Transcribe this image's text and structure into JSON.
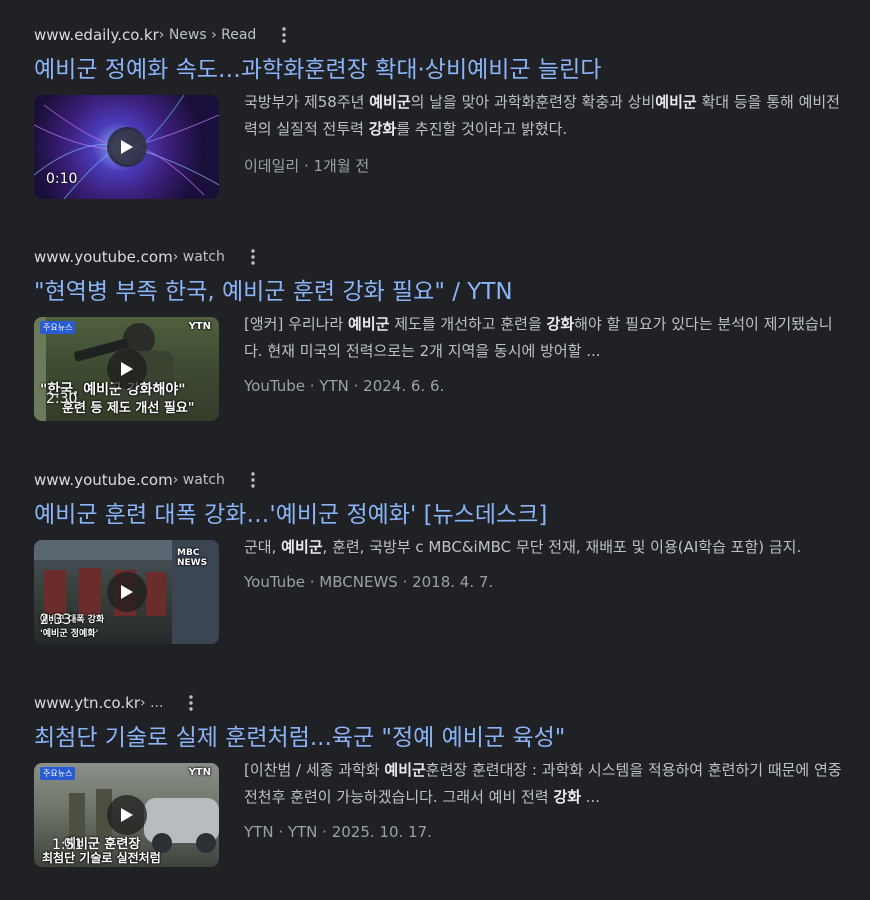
{
  "results": [
    {
      "site": "www.edaily.co.kr",
      "crumb": " › News › Read",
      "title": "예비군 정예화 속도…과학화훈련장 확대·상비예비군 늘린다",
      "duration": "0:10",
      "snippet": [
        {
          "t": "국방부가 제58주년 "
        },
        {
          "b": "예비군"
        },
        {
          "t": "의 날을 맞아 과학화훈련장 확충과 상비"
        },
        {
          "b": "예비군"
        },
        {
          "t": " 확대 등을 통해 예비전력의 실질적 전투력 "
        },
        {
          "b": "강화"
        },
        {
          "t": "를 추진할 것이라고 밝혔다."
        }
      ],
      "meta": "이데일리 · 1개월 전"
    },
    {
      "site": "www.youtube.com",
      "crumb": " › watch",
      "title": "\"현역병 부족 한국, 예비군 훈련 강화 필요\" / YTN",
      "duration": "2:30",
      "thumb_text": [
        "\"한국, 예비군 강화해야\"",
        "훈련 등 제도 개선 필요\""
      ],
      "thumb_badge": "주요뉴스",
      "thumb_logo": "YTN",
      "snippet": [
        {
          "t": "[앵커] 우리나라 "
        },
        {
          "b": "예비군"
        },
        {
          "t": " 제도를 개선하고 훈련을 "
        },
        {
          "b": "강화"
        },
        {
          "t": "해야 할 필요가 있다는 분석이 제기됐습니다. 현재 미국의 전력으로는 2개 지역을 동시에 방어할 ..."
        }
      ],
      "meta": "YouTube · YTN · 2024. 6. 6."
    },
    {
      "site": "www.youtube.com",
      "crumb": " › watch",
      "title": "예비군 훈련 대폭 강화…'예비군 정예화' [뉴스데스크]",
      "duration": "2:33",
      "thumb_text": [
        "예비군 대폭 강화",
        "'예비군 정예화'"
      ],
      "thumb_logo": "MBC NEWS",
      "snippet": [
        {
          "t": "군대, "
        },
        {
          "b": "예비군"
        },
        {
          "t": ", 훈련, 국방부 c MBC&iMBC 무단 전재, 재배포 및 이용(AI학습 포함) 금지."
        }
      ],
      "meta": "YouTube · MBCNEWS · 2018. 4. 7."
    },
    {
      "site": "www.ytn.co.kr",
      "crumb": " › ...",
      "title": "최첨단 기술로 실제 훈련처럼...육군 \"정예 예비군 육성\"",
      "duration": "1:51",
      "thumb_text": [
        "예비군 훈련장",
        "최첨단 기술로 실전처럼"
      ],
      "thumb_badge": "주요뉴스",
      "thumb_logo": "YTN",
      "snippet": [
        {
          "t": "[이찬범 / 세종 과학화 "
        },
        {
          "b": "예비군"
        },
        {
          "t": "훈련장 훈련대장 : 과학화 시스템을 적용하여 훈련하기 때문에 연중 전천후 훈련이 가능하겠습니다. 그래서 예비 전력 "
        },
        {
          "b": "강화"
        },
        {
          "t": " ..."
        }
      ],
      "meta": "YTN · YTN · 2025. 10. 17."
    }
  ],
  "icons": {
    "more": "more-vert-icon",
    "play": "play-icon"
  },
  "colors": {
    "background": "#202124",
    "link": "#8ab4f8",
    "snippet": "#bdc1c6",
    "meta": "#9aa0a6"
  }
}
